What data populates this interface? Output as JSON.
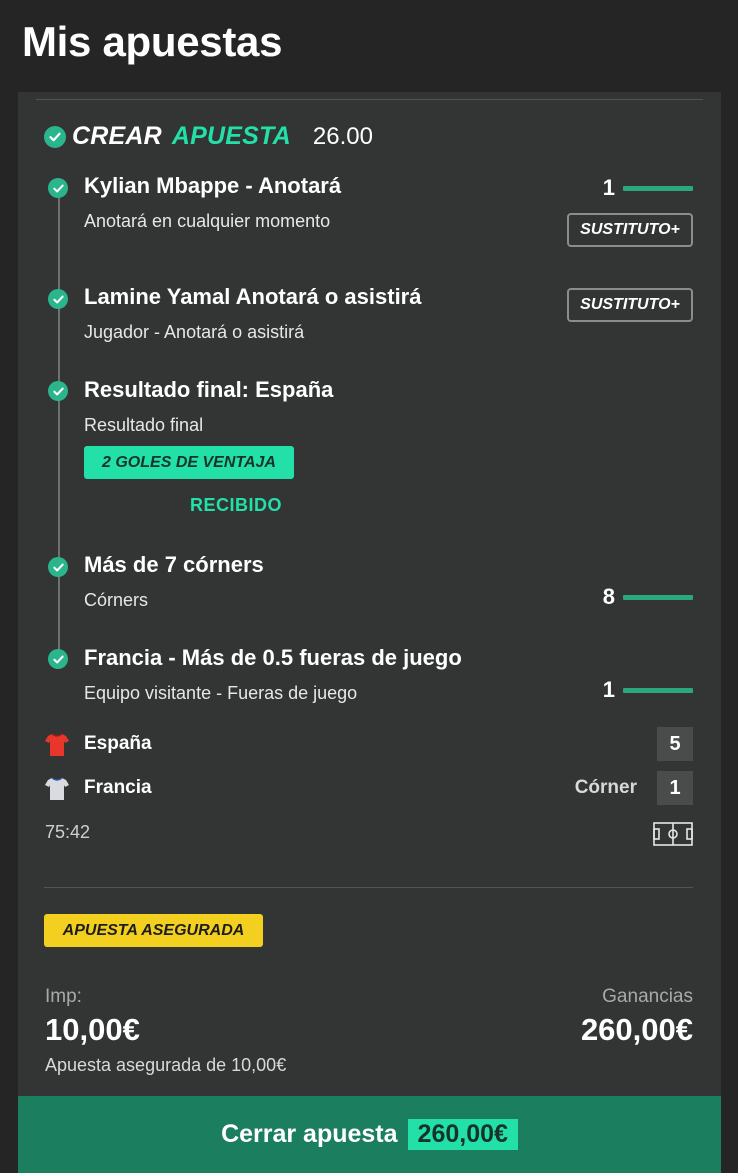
{
  "page": {
    "title": "Mis apuestas"
  },
  "bet": {
    "brand_left": "CREAR",
    "brand_right": "APUESTA",
    "odds": "26.00",
    "selections": [
      {
        "title": "Kylian Mbappe - Anotará",
        "subtitle": "Anotará en cualquier momento",
        "progress": "1",
        "badge": "SUSTITUTO+"
      },
      {
        "title": "Lamine Yamal Anotará o asistirá",
        "subtitle": "Jugador - Anotará o asistirá",
        "badge": "SUSTITUTO+"
      },
      {
        "title": "Resultado final: España",
        "subtitle": "Resultado final",
        "promo_badge": "2 GOLES DE VENTAJA",
        "promo_status": "RECIBIDO"
      },
      {
        "title": "Más de 7 córners",
        "subtitle": "Córners",
        "progress": "8"
      },
      {
        "title": "Francia - Más de 0.5 fueras de juego",
        "subtitle": "Equipo visitante - Fueras de juego",
        "progress": "1"
      }
    ]
  },
  "match": {
    "home": {
      "name": "España",
      "score": "5",
      "shirt_color": "#e8362b",
      "shirt_icon": "shirt-icon"
    },
    "away": {
      "name": "Francia",
      "score": "1",
      "shirt_color": "#d9dbe0",
      "shirt_icon": "shirt-icon",
      "event_label": "Córner"
    },
    "time": "75:42",
    "pitch_icon": "pitch-icon"
  },
  "summary": {
    "insured_badge": "APUESTA ASEGURADA",
    "stake_label": "Imp:",
    "stake_value": "10,00€",
    "winnings_label": "Ganancias",
    "winnings_value": "260,00€",
    "insured_note": "Apuesta asegurada de 10,00€"
  },
  "cashout": {
    "label": "Cerrar apuesta",
    "amount": "260,00€"
  },
  "colors": {
    "background": "#252525",
    "card": "#323533",
    "accent": "#22e0a8",
    "check": "#2bb58c",
    "progress_bar": "#2aa77e",
    "cashout": "#1b7f5f",
    "insured_badge": "#f3cf1f"
  }
}
